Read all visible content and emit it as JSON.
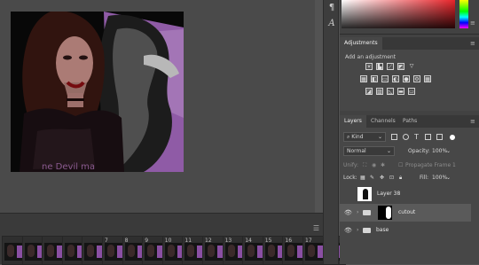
{
  "timeline": {
    "menu_icon": "panel-menu-icon",
    "frames": [
      "",
      "",
      "",
      "",
      "",
      "7",
      "8",
      "9",
      "10",
      "11",
      "12",
      "13",
      "14",
      "15",
      "16",
      "17",
      "18"
    ]
  },
  "tools": [
    "paragraph-icon",
    "character-icon"
  ],
  "panels": {
    "adjustments": {
      "tab": "Adjustments",
      "hint": "Add an adjustment"
    },
    "layers": {
      "tabs": [
        "Layers",
        "Channels",
        "Paths"
      ],
      "filter_kind": "Kind",
      "blend_mode": "Normal",
      "opacity_label": "Opacity:",
      "opacity_value": "100%",
      "unify_label": "Unify:",
      "propagate_label": "Propagate Frame 1",
      "lock_label": "Lock:",
      "fill_label": "Fill:",
      "fill_value": "100%",
      "items": [
        {
          "name": "Layer 38",
          "type": "layer",
          "visible": false,
          "selected": false
        },
        {
          "name": "cutout",
          "type": "group-mask",
          "visible": true,
          "selected": true
        },
        {
          "name": "base",
          "type": "group",
          "visible": true,
          "selected": false
        }
      ]
    }
  },
  "colors": {
    "accent_purple": "#a86bc4",
    "selected_row": "#5a5a5a"
  }
}
